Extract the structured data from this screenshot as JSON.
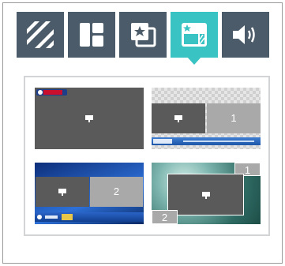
{
  "toolbar": {
    "items": [
      {
        "id": "pattern",
        "icon": "stripes-icon",
        "active": false
      },
      {
        "id": "layout",
        "icon": "layout-grid-icon",
        "active": false
      },
      {
        "id": "overlay",
        "icon": "star-frame-icon",
        "active": false
      },
      {
        "id": "template",
        "icon": "star-template-icon",
        "active": true
      },
      {
        "id": "audio",
        "icon": "speaker-icon",
        "active": false
      }
    ]
  },
  "colors": {
    "toolbar_bg": "#4b5b6a",
    "active_bg": "#39c3c3",
    "screen_dark": "#5a5a5a",
    "screen_light": "#a9a9a9"
  },
  "layouts": {
    "top_right": {
      "slot_number": "1"
    },
    "bottom_left": {
      "slot_number": "2"
    },
    "bottom_right": {
      "slot_number_a": "1",
      "slot_number_b": "2"
    }
  }
}
